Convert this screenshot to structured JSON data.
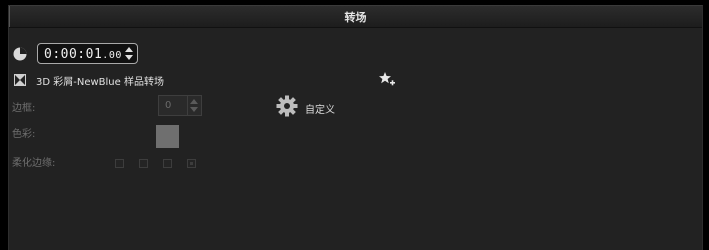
{
  "panel": {
    "title": "转场"
  },
  "timecode": {
    "main": "0:00:01",
    "ms": ".00"
  },
  "transition": {
    "name": "3D 彩屑-NewBlue 样品转场"
  },
  "fields": {
    "border_label": "边框:",
    "border_value": "0",
    "color_label": "色彩:",
    "color_value": "#6f6f6f",
    "soft_edge_label": "柔化边缘:"
  },
  "custom": {
    "label": "自定义"
  },
  "icons": {
    "clock": "clock-icon",
    "transition": "transition-icon",
    "favorite": "add-favorite-icon",
    "gear": "gear-icon"
  }
}
